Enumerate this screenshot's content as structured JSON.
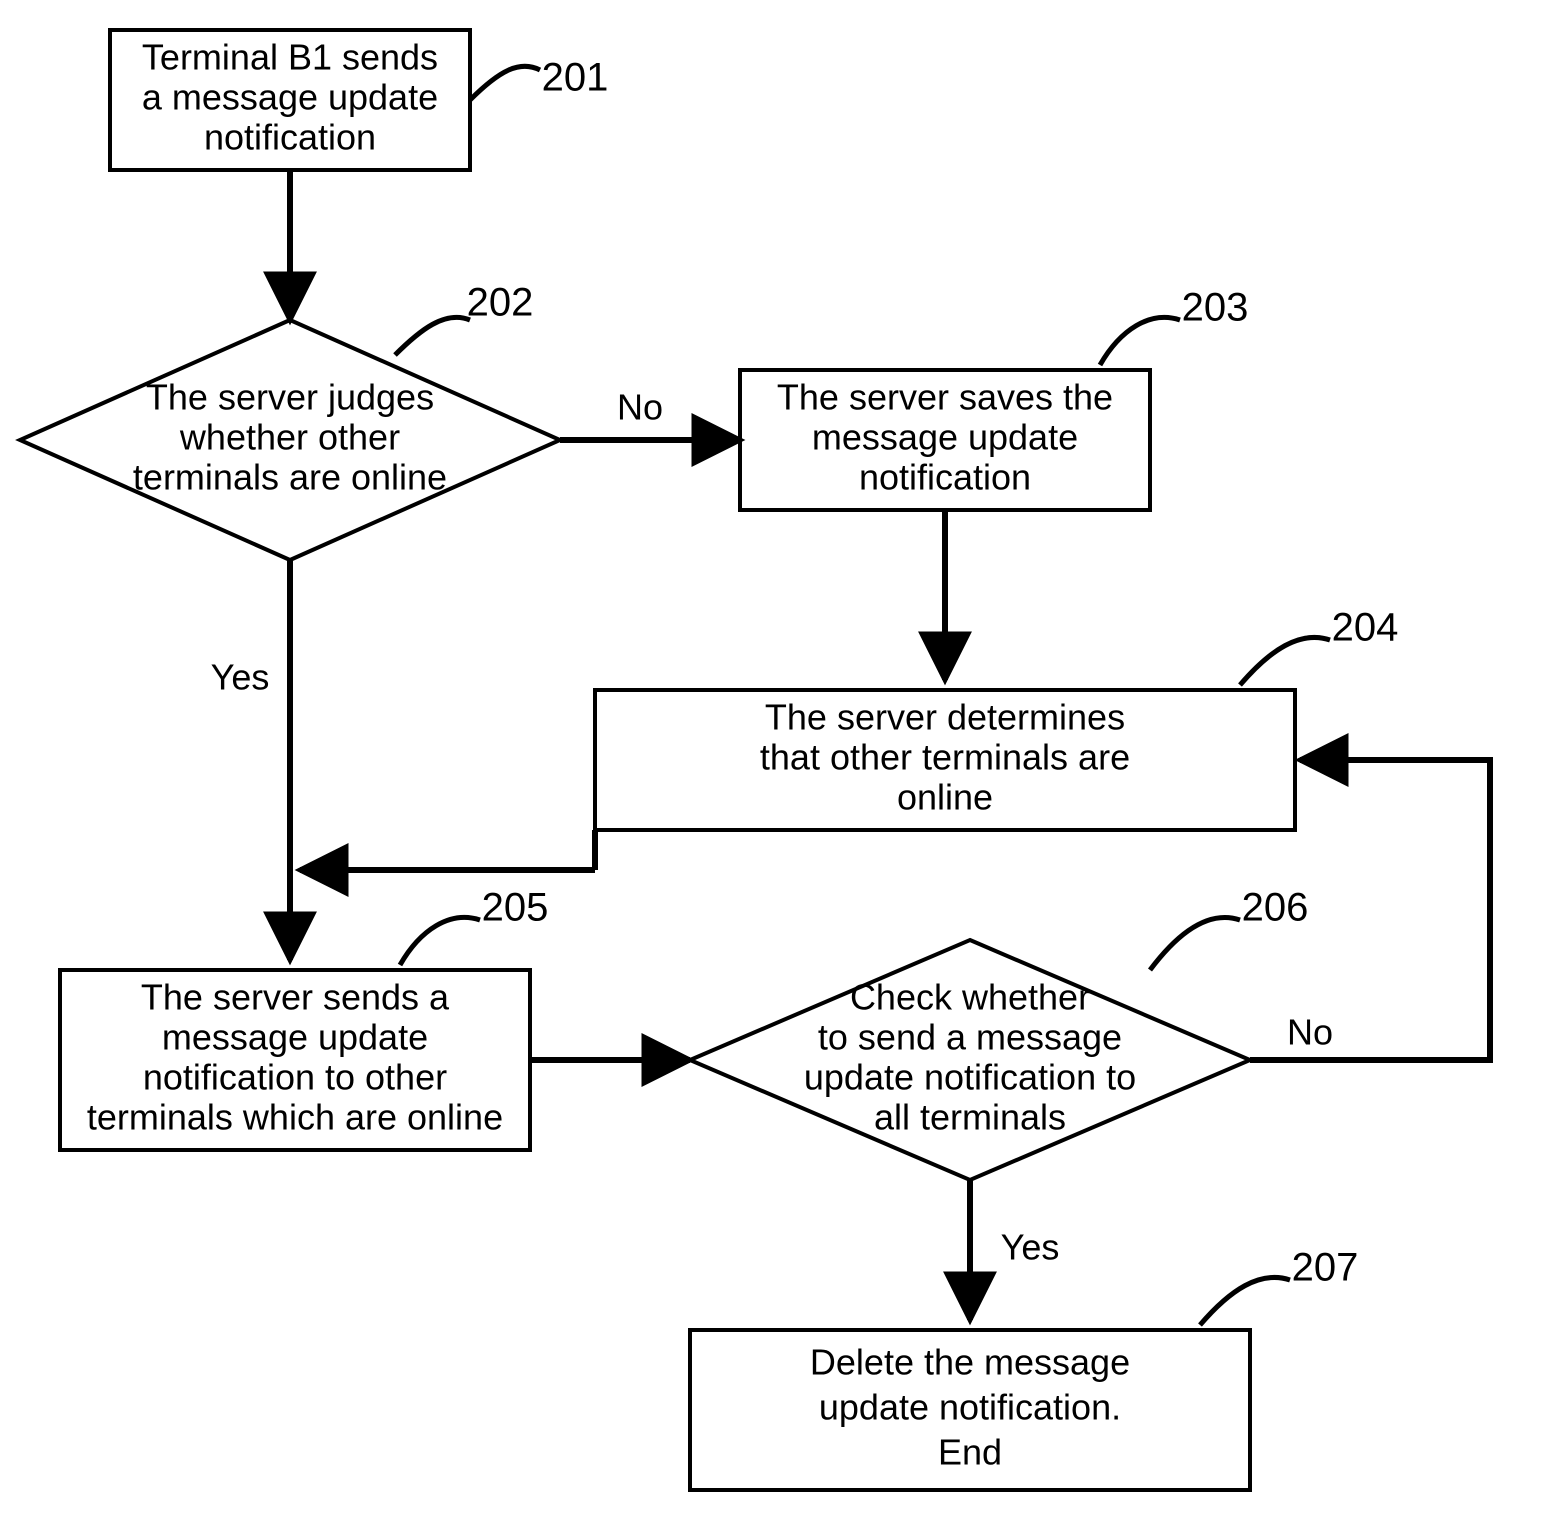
{
  "chart_data": {
    "type": "flowchart",
    "title": "",
    "nodes": [
      {
        "id": "201",
        "type": "process",
        "text": [
          "Terminal B1 sends",
          "a message update",
          "notification"
        ]
      },
      {
        "id": "202",
        "type": "decision",
        "text": [
          "The server judges",
          "whether other",
          "terminals are online"
        ]
      },
      {
        "id": "203",
        "type": "process",
        "text": [
          "The server saves the",
          "message update",
          "notification"
        ]
      },
      {
        "id": "204",
        "type": "process",
        "text": [
          "The server determines",
          "that other terminals are",
          "online"
        ]
      },
      {
        "id": "205",
        "type": "process",
        "text": [
          "The server sends a",
          "message update",
          "notification to other",
          "terminals which are online"
        ]
      },
      {
        "id": "206",
        "type": "decision",
        "text": [
          "Check whether",
          "to send a message",
          "update notification to",
          "all terminals"
        ]
      },
      {
        "id": "207",
        "type": "process",
        "text": [
          "Delete the message",
          "update notification.",
          "End"
        ]
      }
    ],
    "edges": [
      {
        "from": "201",
        "to": "202",
        "label": ""
      },
      {
        "from": "202",
        "to": "203",
        "label": "No"
      },
      {
        "from": "202",
        "to": "205",
        "label": "Yes"
      },
      {
        "from": "203",
        "to": "204",
        "label": ""
      },
      {
        "from": "204",
        "to": "205_merge",
        "label": ""
      },
      {
        "from": "205",
        "to": "206",
        "label": ""
      },
      {
        "from": "206",
        "to": "207",
        "label": "Yes"
      },
      {
        "from": "206",
        "to": "204",
        "label": "No"
      }
    ]
  },
  "labels": {
    "yes": "Yes",
    "no": "No"
  },
  "refs": {
    "n201": "201",
    "n202": "202",
    "n203": "203",
    "n204": "204",
    "n205": "205",
    "n206": "206",
    "n207": "207"
  },
  "nodes": {
    "n201": {
      "l1": "Terminal B1 sends",
      "l2": "a message update",
      "l3": "notification"
    },
    "n202": {
      "l1": "The server judges",
      "l2": "whether other",
      "l3": "terminals are online"
    },
    "n203": {
      "l1": "The server saves the",
      "l2": "message update",
      "l3": "notification"
    },
    "n204": {
      "l1": "The server determines",
      "l2": "that other terminals are",
      "l3": "online"
    },
    "n205": {
      "l1": "The server sends a",
      "l2": "message update",
      "l3": "notification to other",
      "l4": "terminals which are online"
    },
    "n206": {
      "l1": "Check whether",
      "l2": "to send a message",
      "l3": "update notification to",
      "l4": "all terminals"
    },
    "n207": {
      "l1": "Delete the message",
      "l2": "update notification.",
      "l3": "End"
    }
  }
}
